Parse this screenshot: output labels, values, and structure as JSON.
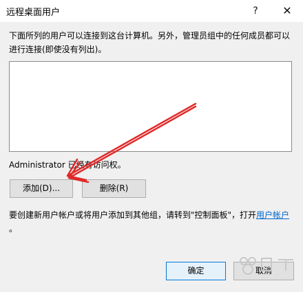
{
  "window": {
    "title": "远程桌面用户",
    "help_label": "?",
    "close_label": "✕"
  },
  "dialog": {
    "description": "下面所列的用户可以连接到这台计算机。另外，管理员组中的任何成员都可以进行连接(即使没有列出)。",
    "user_list": [],
    "status_text": "Administrator 已经有访问权。",
    "add_label": "添加(D)...",
    "remove_label": "删除(R)",
    "info_text": "要创建新用户帐户或将用户添加到其他组，请转到\"控制面板\"，打开",
    "info_link": "用户帐户",
    "info_suffix": "。",
    "ok_label": "确定",
    "cancel_label": "取消"
  },
  "colors": {
    "annotation_arrow": "#e02a2a",
    "link": "#0066cc",
    "dialog_bg": "#f0f0f0",
    "default_button_border": "#0078d7"
  },
  "icons": [
    "help-icon",
    "close-icon"
  ]
}
